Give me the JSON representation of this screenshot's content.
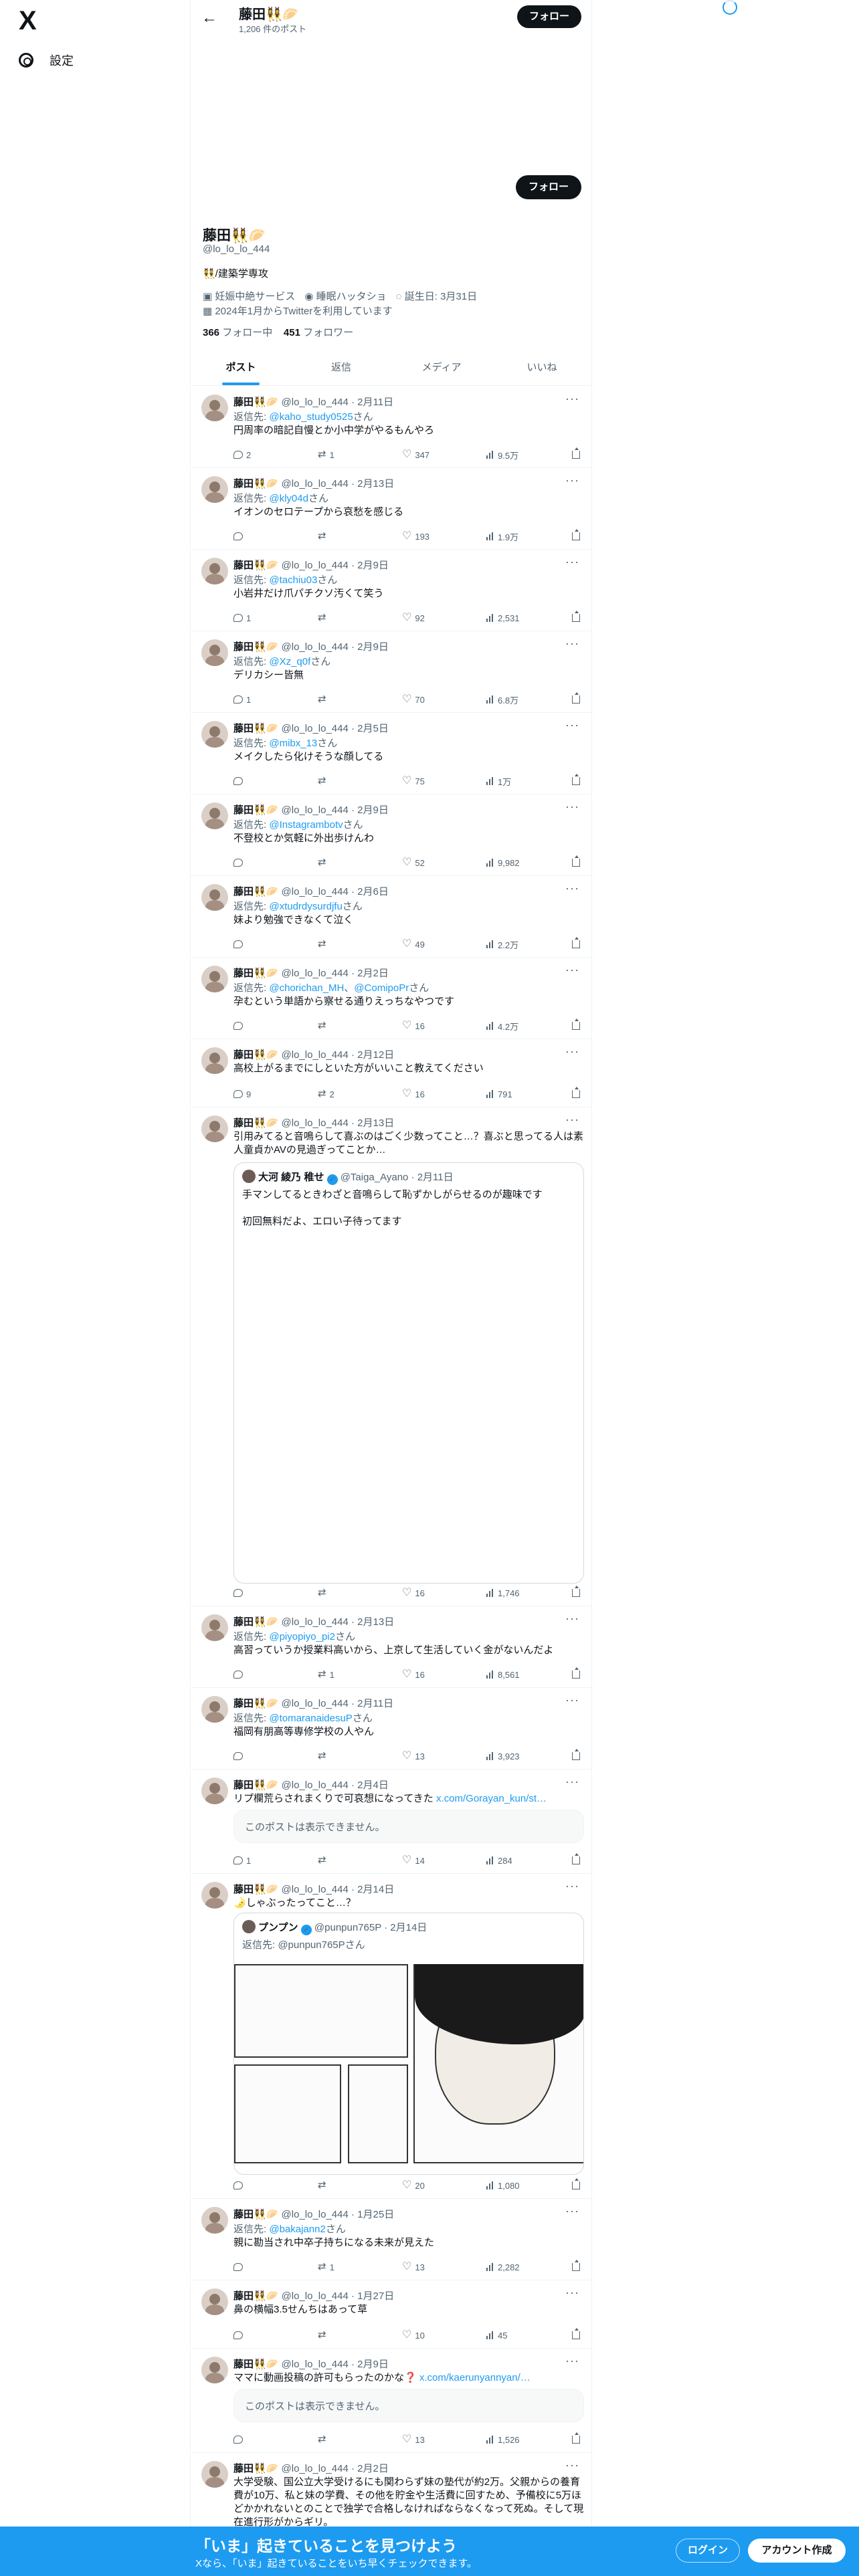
{
  "sidebar": {
    "logo": "X",
    "settings_label": "設定",
    "settings_icon": "gear-icon"
  },
  "header": {
    "name": "藤田👯‍♀️🥟",
    "post_count": "1,206 件のポスト",
    "follow_label": "フォロー"
  },
  "profile": {
    "name": "藤田👯‍♀️🥟",
    "handle": "@lo_lo_lo_444",
    "bio": "👯/建築学専攻",
    "category": "妊娠中絶サービス",
    "location": "睡眠ハッタショ",
    "birthday": "誕生日: 3月31日",
    "joined": "2024年1月からTwitterを利用しています",
    "following_count": "366",
    "following_label": "フォロー中",
    "followers_count": "451",
    "followers_label": "フォロワー",
    "follow_label": "フォロー"
  },
  "tabs": [
    "ポスト",
    "返信",
    "メディア",
    "いいね"
  ],
  "tweets": [
    {
      "name": "藤田👯‍♀️🥟",
      "meta": "@lo_lo_lo_444 · 2月11日",
      "reply_prefix": "返信先: ",
      "reply_to": "@kaho_study0525",
      "reply_suffix": "さん",
      "text": "円周率の暗記自慢とか小中学がやるもんやろ",
      "replies": "2",
      "retweets": "1",
      "likes": "347",
      "views": "9.5万"
    },
    {
      "name": "藤田👯‍♀️🥟",
      "meta": "@lo_lo_lo_444 · 2月13日",
      "reply_prefix": "返信先: ",
      "reply_to": "@kly04d",
      "reply_suffix": "さん",
      "text": "イオンのセロテープから哀愁を感じる",
      "replies": "",
      "retweets": "",
      "likes": "193",
      "views": "1.9万"
    },
    {
      "name": "藤田👯‍♀️🥟",
      "meta": "@lo_lo_lo_444 · 2月9日",
      "reply_prefix": "返信先: ",
      "reply_to": "@tachiu03",
      "reply_suffix": "さん",
      "text": "小岩井だけ爪パチクソ汚くて笑う",
      "replies": "1",
      "retweets": "",
      "likes": "92",
      "views": "2,531"
    },
    {
      "name": "藤田👯‍♀️🥟",
      "meta": "@lo_lo_lo_444 · 2月9日",
      "reply_prefix": "返信先: ",
      "reply_to": "@Xz_q0f",
      "reply_suffix": "さん",
      "text": "デリカシー皆無",
      "replies": "1",
      "retweets": "",
      "likes": "70",
      "views": "6.8万"
    },
    {
      "name": "藤田👯‍♀️🥟",
      "meta": "@lo_lo_lo_444 · 2月5日",
      "reply_prefix": "返信先: ",
      "reply_to": "@mibx_13",
      "reply_suffix": "さん",
      "text": "メイクしたら化けそうな顔してる",
      "replies": "",
      "retweets": "",
      "likes": "75",
      "views": "1万"
    },
    {
      "name": "藤田👯‍♀️🥟",
      "meta": "@lo_lo_lo_444 · 2月9日",
      "reply_prefix": "返信先: ",
      "reply_to": "@Instagrambotv",
      "reply_suffix": "さん",
      "text": "不登校とか気軽に外出歩けんわ",
      "replies": "",
      "retweets": "",
      "likes": "52",
      "views": "9,982"
    },
    {
      "name": "藤田👯‍♀️🥟",
      "meta": "@lo_lo_lo_444 · 2月6日",
      "reply_prefix": "返信先: ",
      "reply_to": "@xtudrdysurdjfu",
      "reply_suffix": "さん",
      "text": "妹より勉強できなくて泣く",
      "replies": "",
      "retweets": "",
      "likes": "49",
      "views": "2.2万"
    },
    {
      "name": "藤田👯‍♀️🥟",
      "meta": "@lo_lo_lo_444 · 2月2日",
      "reply_prefix": "返信先: ",
      "reply_to": "@chorichan_MH",
      "reply_to2": "@ComipoPr",
      "reply_suffix": "さん",
      "text": "孕むという単語から察せる通りえっちなやつです",
      "replies": "",
      "retweets": "",
      "likes": "16",
      "views": "4.2万"
    },
    {
      "name": "藤田👯‍♀️🥟",
      "meta": "@lo_lo_lo_444 · 2月12日",
      "text": "高校上がるまでにしといた方がいいこと教えてください",
      "replies": "9",
      "retweets": "2",
      "likes": "16",
      "views": "791"
    },
    {
      "name": "藤田👯‍♀️🥟",
      "meta": "@lo_lo_lo_444 · 2月13日",
      "text": "引用みてると音鳴らして喜ぶのはごく少数ってこと…？喜ぶと思ってる人は素人童貞かAVの見過ぎってことか…",
      "quote_name": "大河 綾乃 稚せ",
      "quote_meta": "@Taiga_Ayano · 2月11日",
      "quote_text1": "手マンしてるときわざと音鳴らして恥ずかしがらせるのが趣味です",
      "quote_text2": "初回無料だよ、エロい子待ってます",
      "replies": "",
      "retweets": "",
      "likes": "16",
      "views": "1,746"
    },
    {
      "name": "藤田👯‍♀️🥟",
      "meta": "@lo_lo_lo_444 · 2月13日",
      "reply_prefix": "返信先: ",
      "reply_to": "@piyopiyo_pi2",
      "reply_suffix": "さん",
      "text": "高習っていうか授業料高いから、上京して生活していく金がないんだよ",
      "replies": "",
      "retweets": "1",
      "likes": "16",
      "views": "8,561"
    },
    {
      "name": "藤田👯‍♀️🥟",
      "meta": "@lo_lo_lo_444 · 2月11日",
      "reply_prefix": "返信先: ",
      "reply_to": "@tomaranaidesuP",
      "reply_suffix": "さん",
      "text": "福岡有朋高等専修学校の人やん",
      "replies": "",
      "retweets": "",
      "likes": "13",
      "views": "3,923"
    },
    {
      "name": "藤田👯‍♀️🥟",
      "meta": "@lo_lo_lo_444 · 2月4日",
      "text": "リプ欄荒らされまくりで可哀想になってきた ",
      "link": "x.com/Gorayan_kun/st…",
      "unavailable": "このポストは表示できません。",
      "replies": "1",
      "retweets": "",
      "likes": "14",
      "views": "284"
    },
    {
      "name": "藤田👯‍♀️🥟",
      "meta": "@lo_lo_lo_444 · 2月14日",
      "text": "🌛しゃぶったってこと…？",
      "quote_name": "プンプン",
      "quote_meta": "@punpun765P · 2月14日",
      "quote_reply": "返信先: @punpun765Pさん",
      "replies": "",
      "retweets": "",
      "likes": "20",
      "views": "1,080"
    },
    {
      "name": "藤田👯‍♀️🥟",
      "meta": "@lo_lo_lo_444 · 1月25日",
      "reply_prefix": "返信先: ",
      "reply_to": "@bakajann2",
      "reply_suffix": "さん",
      "text": "親に勘当され中卒子持ちになる未来が見えた",
      "replies": "",
      "retweets": "1",
      "likes": "13",
      "views": "2,282"
    },
    {
      "name": "藤田👯‍♀️🥟",
      "meta": "@lo_lo_lo_444 · 1月27日",
      "text": "鼻の横幅3.5せんちはあって草",
      "replies": "",
      "retweets": "",
      "likes": "10",
      "views": "45"
    },
    {
      "name": "藤田👯‍♀️🥟",
      "meta": "@lo_lo_lo_444 · 2月9日",
      "text": "ママに動画投稿の許可もらったのかな❓ ",
      "link": "x.com/kaerunyannyan/…",
      "unavailable": "このポストは表示できません。",
      "replies": "",
      "retweets": "",
      "likes": "13",
      "views": "1,526"
    },
    {
      "name": "藤田👯‍♀️🥟",
      "meta": "@lo_lo_lo_444 · 2月2日",
      "text": "大学受験、国公立大学受けるにも関わらず妹の塾代が約2万。父親からの養育費が10万、私と妹の学費、その他を貯金や生活費に回すため、予備校に5万ほどかかれないとのことで独学で合格しなければならなくなって死ぬ。そして現在進行形がからギリ。"
    }
  ],
  "banner": {
    "title": "「いま」起きていることを見つけよう",
    "subtitle": "Xなら、「いま」起きていることをいち早くチェックできます。",
    "login_label": "ログイン",
    "signup_label": "アカウント作成"
  }
}
